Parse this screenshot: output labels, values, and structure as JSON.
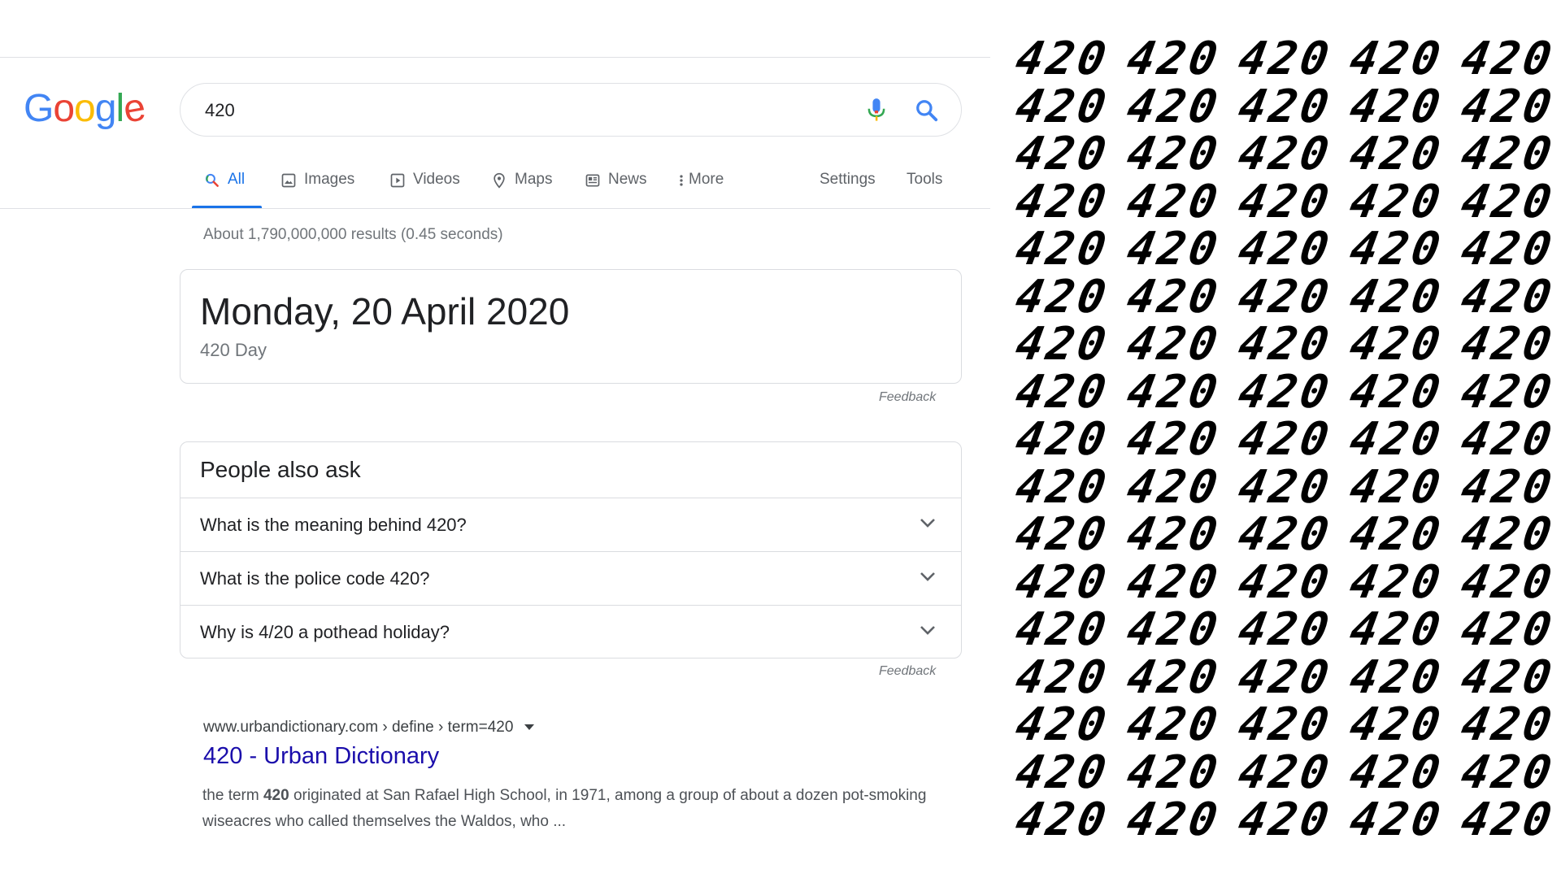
{
  "logo": {
    "letters": [
      "G",
      "o",
      "o",
      "g",
      "l",
      "e"
    ],
    "colors": [
      "#4285F4",
      "#EA4335",
      "#FBBC05",
      "#4285F4",
      "#34A853",
      "#EA4335"
    ]
  },
  "search": {
    "query": "420",
    "icons": [
      "microphone-icon",
      "search-icon"
    ],
    "colors": {
      "blue": "#4285F4",
      "red": "#EA4335",
      "yellow": "#FBBC05",
      "green": "#34A853"
    }
  },
  "tabs": [
    {
      "label": "All",
      "icon": "search-icon",
      "active": true
    },
    {
      "label": "Images",
      "icon": "image-icon"
    },
    {
      "label": "Videos",
      "icon": "play-icon"
    },
    {
      "label": "Maps",
      "icon": "map-pin-icon"
    },
    {
      "label": "News",
      "icon": "news-icon"
    },
    {
      "label": "More",
      "icon": "more-vert-icon"
    }
  ],
  "tools": {
    "settings": "Settings",
    "tools": "Tools"
  },
  "result_stats": "About 1,790,000,000 results (0.45 seconds)",
  "answer": {
    "date": "Monday, 20 April 2020",
    "subtitle": "420 Day"
  },
  "feedback": "Feedback",
  "paa": {
    "title": "People also ask",
    "questions": [
      "What is the meaning behind 420?",
      "What is the police code 420?",
      "Why is 4/20 a pothead holiday?"
    ]
  },
  "result": {
    "url": "www.urbandictionary.com › define › term=420",
    "title": "420 - Urban Dictionary",
    "snippet_pre": "the term ",
    "snippet_bold": "420",
    "snippet_post": " originated at San Rafael High School, in 1971, among a group of about a dozen pot-smoking wiseacres who called themselves the Waldos, who ..."
  },
  "pattern": {
    "text": "420",
    "rows": 17,
    "cols": 5,
    "color": "#000000"
  }
}
